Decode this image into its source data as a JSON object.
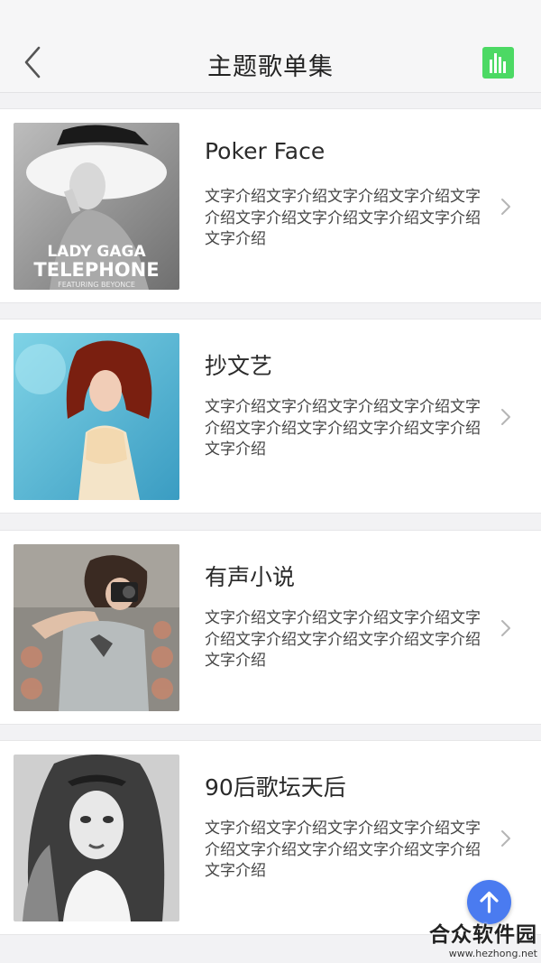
{
  "header": {
    "title": "主题歌单集",
    "back_icon": "chevron-left-icon",
    "action_icon": "bar-chart-icon",
    "action_color": "#4cd964"
  },
  "playlists": [
    {
      "title": "Poker Face",
      "description": "文字介绍文字介绍文字介绍文字介绍文字介绍文字介绍文字介绍文字介绍文字介绍文字介绍",
      "cover_text_line1": "LADY GAGA",
      "cover_text_line2": "TELEPHONE",
      "cover_text_line3": "FEATURING BEYONCE"
    },
    {
      "title": "抄文艺",
      "description": "文字介绍文字介绍文字介绍文字介绍文字介绍文字介绍文字介绍文字介绍文字介绍文字介绍"
    },
    {
      "title": "有声小说",
      "description": "文字介绍文字介绍文字介绍文字介绍文字介绍文字介绍文字介绍文字介绍文字介绍文字介绍"
    },
    {
      "title": "90后歌坛天后",
      "description": "文字介绍文字介绍文字介绍文字介绍文字介绍文字介绍文字介绍文字介绍文字介绍文字介绍"
    }
  ],
  "fab": {
    "icon": "arrow-up-icon",
    "color": "#4a7bf0"
  },
  "watermark": {
    "main": "合众软件园",
    "sub": "www.hezhong.net"
  }
}
